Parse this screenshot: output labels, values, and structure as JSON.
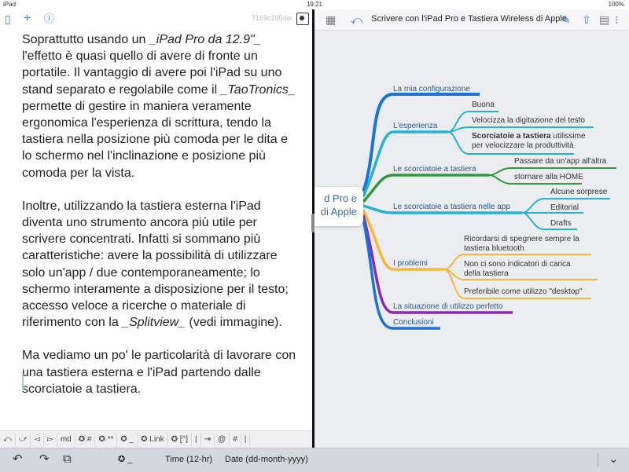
{
  "status": {
    "carrier": "iPad",
    "time": "19:21",
    "battery": "100%"
  },
  "editor": {
    "hash": "7169c1054w",
    "paragraphs": [
      [
        {
          "t": "Soprattutto usando un "
        },
        {
          "t": "_iPad Pro da 12.9\"_",
          "i": true
        },
        {
          "t": " l'effetto è quasi quello di avere di fronte un portatile. Il vantaggio di avere poi l'iPad su uno stand separato e regolabile come il "
        },
        {
          "t": "_TaoTronics_",
          "i": true
        },
        {
          "t": " permette di gestire in maniera veramente ergonomica l'esperienza di scrittura, tendo la tastiera nella posizione più comoda per le dita e lo schermo nel l'inclinazione e posizione più comoda per la vista."
        }
      ],
      [
        {
          "t": "Inoltre, utilizzando la tastiera esterna l'iPad diventa uno strumento ancora più utile per scrivere concentrati. Infatti si sommano più caratteristiche: avere la possibilità di utilizzare solo un'app / due contemporaneamente; lo schermo interamente a disposizione per il testo; accesso veloce a ricerche o materiale di riferimento con la "
        },
        {
          "t": "_Splitview_",
          "i": true
        },
        {
          "t": "  (vedi immagine)."
        }
      ],
      [
        {
          "t": "Ma vediamo un po' le particolarità di lavorare con una tastiera esterna e l'iPad partendo dalle scorciatoie a tastiera."
        }
      ]
    ],
    "kbbar": [
      "⤺",
      "⤻",
      "◅",
      "▻",
      "md",
      "✪ #",
      "✪ **",
      "✪ _",
      "✪ Link",
      "✪ [^]",
      "|",
      "⇥",
      "@",
      "#",
      "|"
    ]
  },
  "mindmap": {
    "title": "Scrivere con l'iPad Pro e Tastiera Wireless di Apple",
    "center_line1": "d Pro e",
    "center_line2": "di Apple",
    "branches": [
      "La mia configurazione",
      "L'esperienza",
      "Le scorciatoie a tastiera",
      "Le scorciatoie a tastiera nelle app",
      "I problemi",
      "La situazione di utilizzo perfetto",
      "Conclusioni"
    ],
    "esperienza": [
      "Buona",
      "Velocizza la digitazione del testo",
      "Scorciatoie a tastiera",
      "utilissime",
      "per velocizzare la produttività"
    ],
    "scorciatoie": [
      "Passare da un'app all'altra",
      "stornare alla HOME"
    ],
    "app": [
      "Alcune sorprese",
      "Editorial",
      "Drafts"
    ],
    "problemi": [
      "Ricordarsi di spegnere sempre la",
      "tastiera bluetooth",
      "Non ci sono indicatori di carica",
      "della tastiera",
      "Preferibile come utilizzo \"desktop\""
    ],
    "colors": {
      "blue": "#1a74d4",
      "cyan": "#22b3d6",
      "green": "#2e9a3e",
      "yellow": "#f4b83a",
      "purple": "#8a2ab8"
    }
  },
  "bottombar": {
    "gear": "✪ _",
    "time_label": "Time (12-hr)",
    "date_label": "Date (dd-month-yyyy)"
  }
}
